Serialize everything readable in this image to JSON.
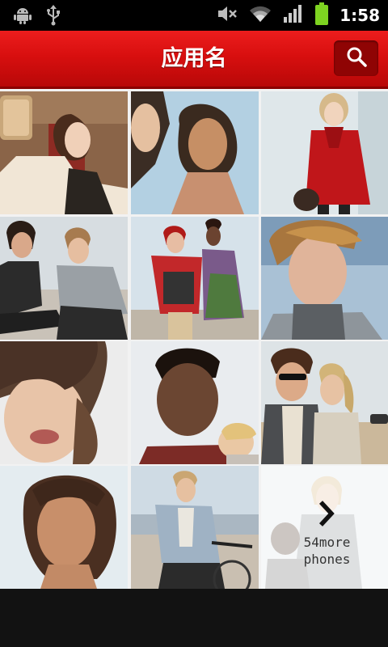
{
  "status_bar": {
    "time": "1:58",
    "icons": [
      "android-debug-icon",
      "usb-icon",
      "mute-icon",
      "wifi-icon",
      "signal-icon",
      "battery-icon"
    ],
    "battery_color": "#7ed321"
  },
  "app_bar": {
    "title": "应用名",
    "search_icon": "search-icon",
    "bar_color": "#d80f0f",
    "button_color": "#8f0404"
  },
  "gallery": {
    "more_count": "54",
    "more_label_line1": "54more",
    "more_label_line2": "phones",
    "more_icon": "chevron-right-icon"
  }
}
